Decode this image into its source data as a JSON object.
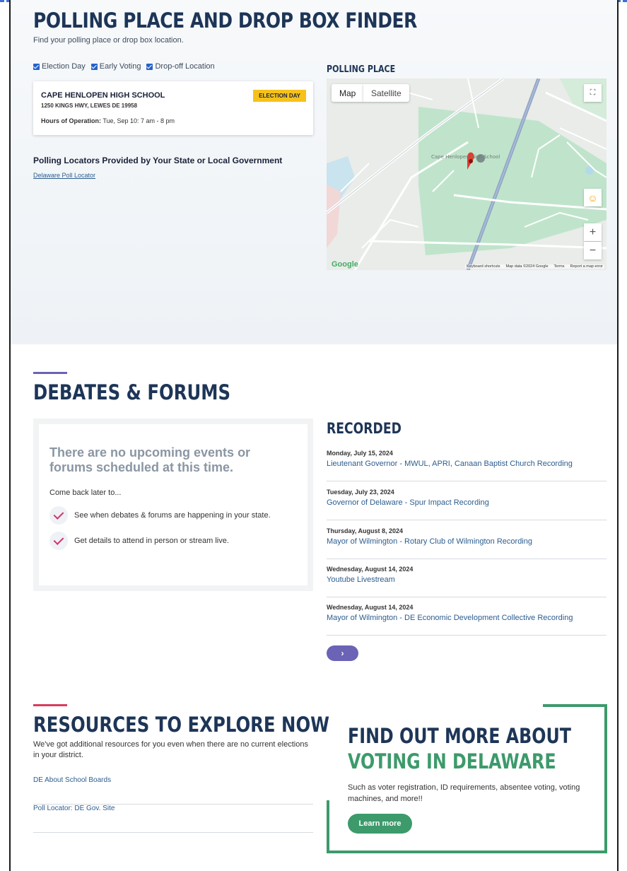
{
  "polling": {
    "title": "POLLING PLACE AND DROP BOX FINDER",
    "subtitle": "Find your polling place or drop box location.",
    "filters": [
      {
        "label": "Election Day",
        "checked": true
      },
      {
        "label": "Early Voting",
        "checked": true
      },
      {
        "label": "Drop-off Location",
        "checked": true
      }
    ],
    "location": {
      "name": "CAPE HENLOPEN HIGH SCHOOL",
      "address": "1250 KINGS HWY, LEWES DE 19958",
      "hours_label": "Hours of Operation:",
      "hours_value": " Tue, Sep 10: 7 am - 8 pm",
      "badge": "ELECTION DAY"
    },
    "gov_heading": "Polling Locators Provided by Your State or Local Government",
    "gov_link": "Delaware Poll Locator",
    "map": {
      "label": "POLLING PLACE",
      "map_tab": "Map",
      "satellite_tab": "Satellite",
      "place_name": "Cape Henlopen High School",
      "google": "Google",
      "footer": [
        "Keyboard shortcuts",
        "Map data ©2024 Google",
        "Terms",
        "Report a map error"
      ],
      "zoom_in": "+",
      "zoom_out": "−"
    }
  },
  "debates": {
    "title": "DEBATES & FORUMS",
    "accent_color": "#6b63b5",
    "no_events": "There are no upcoming events or forums scheduled at this time.",
    "come_back": "Come back later to...",
    "checks": [
      "See when debates & forums are happening in your state.",
      "Get details to attend in person or stream live."
    ],
    "recorded_title": "RECORDED",
    "recorded": [
      {
        "date": "Monday, July 15, 2024",
        "title": "Lieutenant Governor - MWUL, APRI, Canaan Baptist Church Recording"
      },
      {
        "date": "Tuesday, July 23, 2024",
        "title": "Governor of Delaware - Spur Impact Recording"
      },
      {
        "date": "Thursday, August 8, 2024",
        "title": "Mayor of Wilmington - Rotary Club of Wilmington Recording"
      },
      {
        "date": "Wednesday, August 14, 2024",
        "title": "Youtube Livestream"
      },
      {
        "date": "Wednesday, August 14, 2024",
        "title": "Mayor of Wilmington - DE Economic Development Collective Recording"
      }
    ],
    "pager_icon": "›"
  },
  "resources": {
    "title": "RESOURCES TO EXPLORE NOW",
    "accent_color": "#d93b5e",
    "description": "We've got additional resources for you even when there are no current elections in your district.",
    "links": [
      "DE About School Boards",
      "Poll Locator: DE Gov. Site"
    ],
    "find_more": {
      "line1": "FIND OUT MORE ABOUT",
      "line2": "VOTING IN DELAWARE",
      "description": "Such as voter registration, ID requirements, absentee voting, voting machines, and more!!",
      "button": "Learn more",
      "accent_color": "#3d9a6b"
    }
  }
}
